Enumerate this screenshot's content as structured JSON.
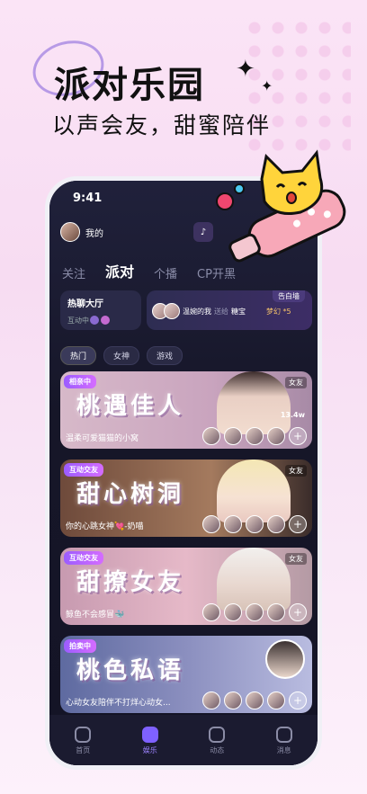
{
  "promo": {
    "title": "派对乐园",
    "subtitle": "以声会友，甜蜜陪伴"
  },
  "status": {
    "time": "9:41"
  },
  "me": {
    "label": "我的"
  },
  "tabs": [
    {
      "label": "关注"
    },
    {
      "label": "派对"
    },
    {
      "label": "个播"
    },
    {
      "label": "CP开黑"
    }
  ],
  "hall": {
    "title": "热聊大厅",
    "sub": "互动中"
  },
  "wall": {
    "tag": "告白墙",
    "from": "温婉的我",
    "action": "送给",
    "to": "糖宝",
    "gift": "梦幻 *5"
  },
  "chips": [
    {
      "label": "热门"
    },
    {
      "label": "女神"
    },
    {
      "label": "游戏"
    }
  ],
  "rooms": [
    {
      "badge": "相亲中",
      "art": "桃遇佳人",
      "name": "温柔可爱猫猫的小窝",
      "tag": "女友",
      "count": "13.4w"
    },
    {
      "badge": "互动交友",
      "art": "甜心树洞",
      "name": "你的心跳女神💘-奶喵",
      "tag": "女友",
      "count": ""
    },
    {
      "badge": "互动交友",
      "art": "甜撩女友",
      "name": "鲸鱼不会感冒🐳",
      "tag": "女友",
      "count": ""
    },
    {
      "badge": "拍卖中",
      "art": "桃色私语",
      "name": "心动女友陪伴不打烊心动女...",
      "tag": "",
      "count": ""
    }
  ],
  "nav": [
    {
      "label": "首页"
    },
    {
      "label": "娱乐"
    },
    {
      "label": "动态"
    },
    {
      "label": "消息"
    }
  ]
}
